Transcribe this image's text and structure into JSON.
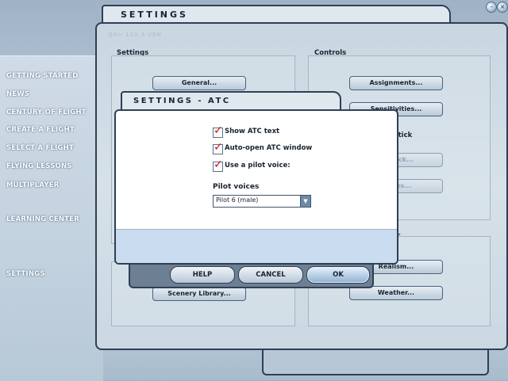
{
  "window": {
    "title": "SETTINGS",
    "watermark": "QAI- 110.3 VEN"
  },
  "sidebar": {
    "items": [
      {
        "label": "GETTING STARTED"
      },
      {
        "label": "NEWS"
      },
      {
        "label": "CENTURY OF FLIGHT"
      },
      {
        "label": "CREATE A FLIGHT"
      },
      {
        "label": "SELECT A FLIGHT"
      },
      {
        "label": "FLYING LESSONS"
      },
      {
        "label": "MULTIPLAYER"
      },
      {
        "label": "LEARNING CENTER"
      },
      {
        "label": "SETTINGS"
      }
    ]
  },
  "settings_panel": {
    "label": "Settings",
    "buttons": {
      "general": "General...",
      "scenery": "Scenery Library..."
    }
  },
  "controls_panel": {
    "label": "Controls",
    "buttons": {
      "assignments": "Assignments...",
      "sensitivities": "Sensitivities...",
      "joystick": "Joystick...",
      "forces": "Forces..."
    },
    "joystick_label": "Joystick"
  },
  "other_panel": {
    "label_fragment": "r",
    "buttons": {
      "realism": "Realism...",
      "weather": "Weather..."
    }
  },
  "atc_dialog": {
    "title": "SETTINGS - ATC",
    "options": [
      {
        "label": "Show ATC text",
        "checked": true
      },
      {
        "label": "Auto-open ATC window",
        "checked": true
      },
      {
        "label": "Use a pilot voice:",
        "checked": true
      }
    ],
    "voices_label": "Pilot voices",
    "voice_selected": "Pilot 6 (male)",
    "buttons": {
      "help": "HELP",
      "cancel": "CANCEL",
      "ok": "OK"
    }
  },
  "colors": {
    "accent": "#2f3f55",
    "check": "#cc1010",
    "footer": "#c9dcf0"
  },
  "icons": {
    "dropdown": "chevron-down-icon",
    "check": "checkmark-icon"
  }
}
